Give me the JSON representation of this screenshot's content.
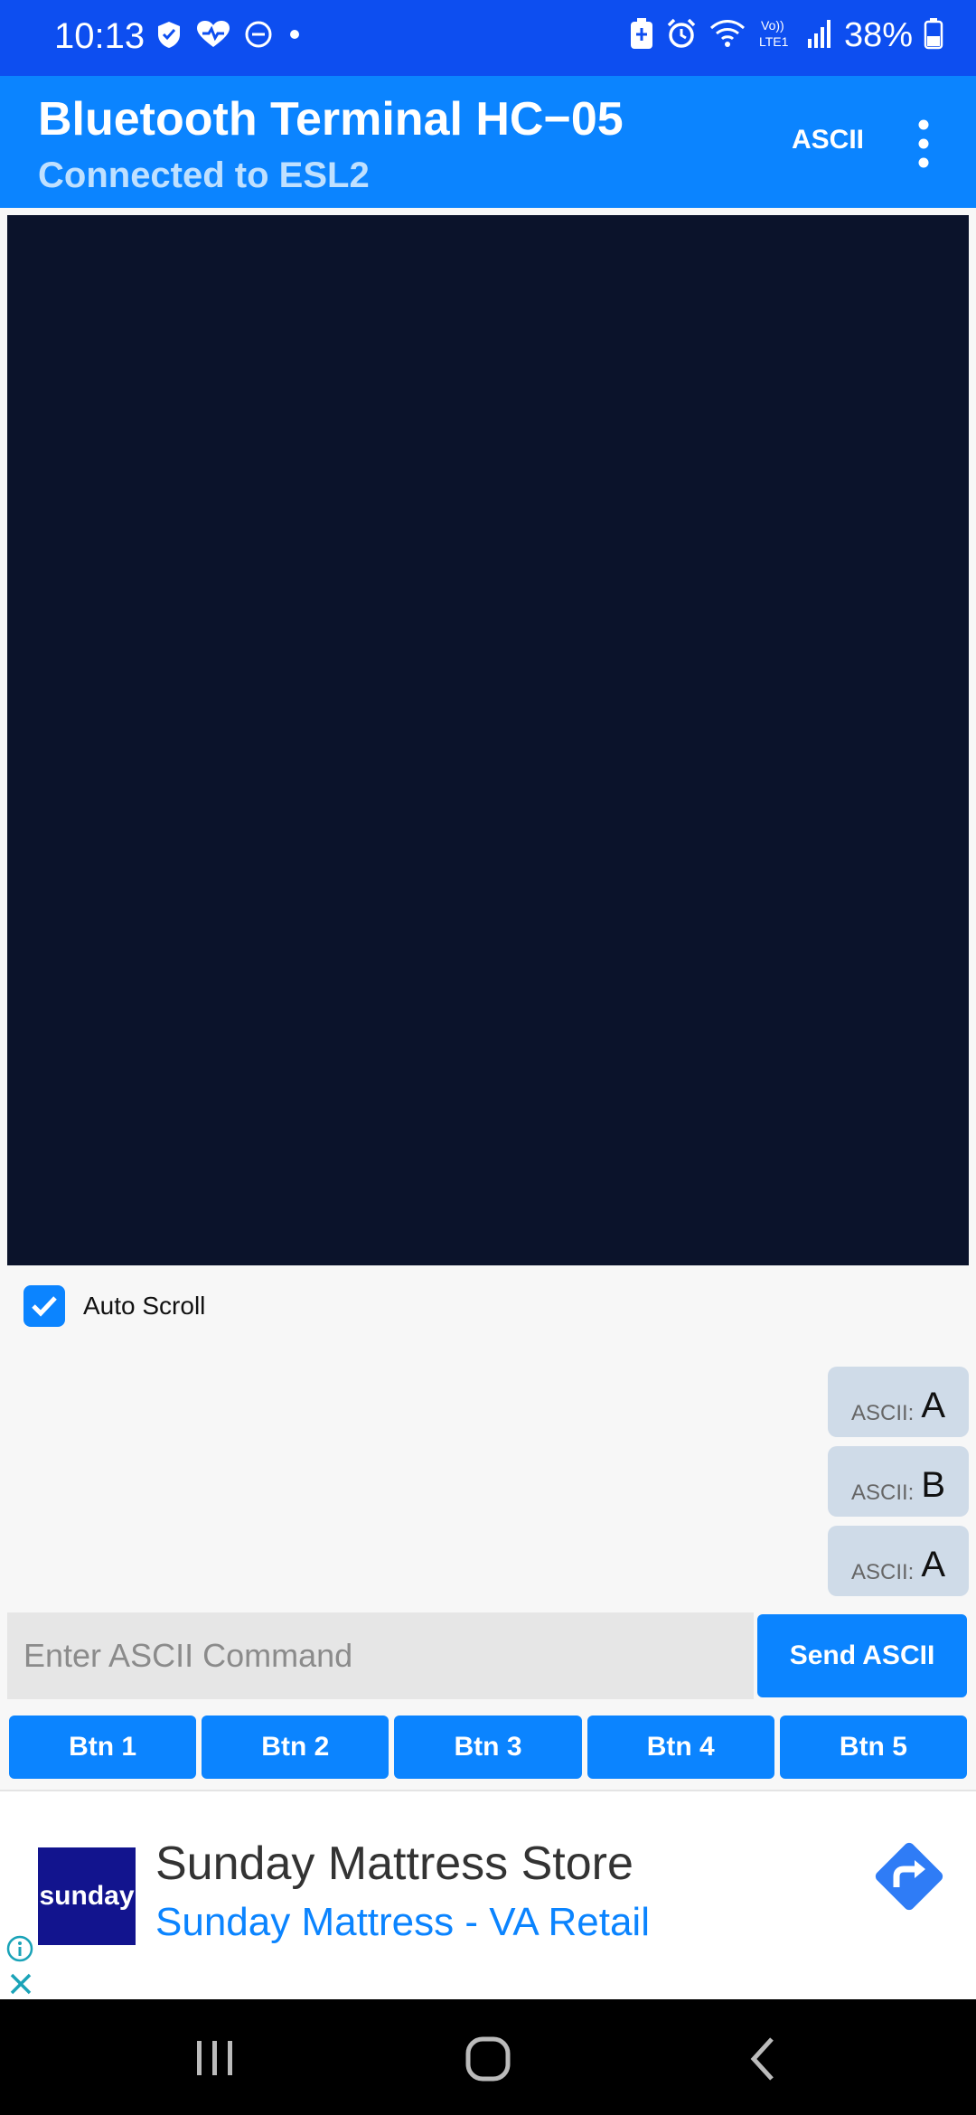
{
  "status_bar": {
    "time": "10:13",
    "battery": "38%",
    "left_icons": [
      "shield-icon",
      "heart-icon",
      "dnd-icon",
      "dot-icon"
    ],
    "right_icons": [
      "battery-saver-icon",
      "alarm-icon",
      "wifi-icon",
      "volte-icon",
      "signal-icon",
      "battery-icon"
    ]
  },
  "app_bar": {
    "title": "Bluetooth Terminal HC−05",
    "subtitle": "Connected to ESL2",
    "mode": "ASCII"
  },
  "auto_scroll": {
    "label": "Auto Scroll",
    "checked": true
  },
  "history": [
    {
      "prefix": "ASCII:",
      "char": "A"
    },
    {
      "prefix": "ASCII:",
      "char": "B"
    },
    {
      "prefix": "ASCII:",
      "char": "A"
    }
  ],
  "command": {
    "placeholder": "Enter ASCII Command",
    "value": "",
    "send_label": "Send ASCII"
  },
  "buttons": [
    "Btn 1",
    "Btn 2",
    "Btn 3",
    "Btn 4",
    "Btn 5"
  ],
  "ad": {
    "logo_text": "sunday",
    "title": "Sunday Mattress Store",
    "subtitle": "Sunday Mattress - VA Retail"
  },
  "colors": {
    "status_bar": "#0d4ef0",
    "app_bar": "#0b84ff",
    "terminal": "#0b132b",
    "accent": "#0b84ff"
  }
}
